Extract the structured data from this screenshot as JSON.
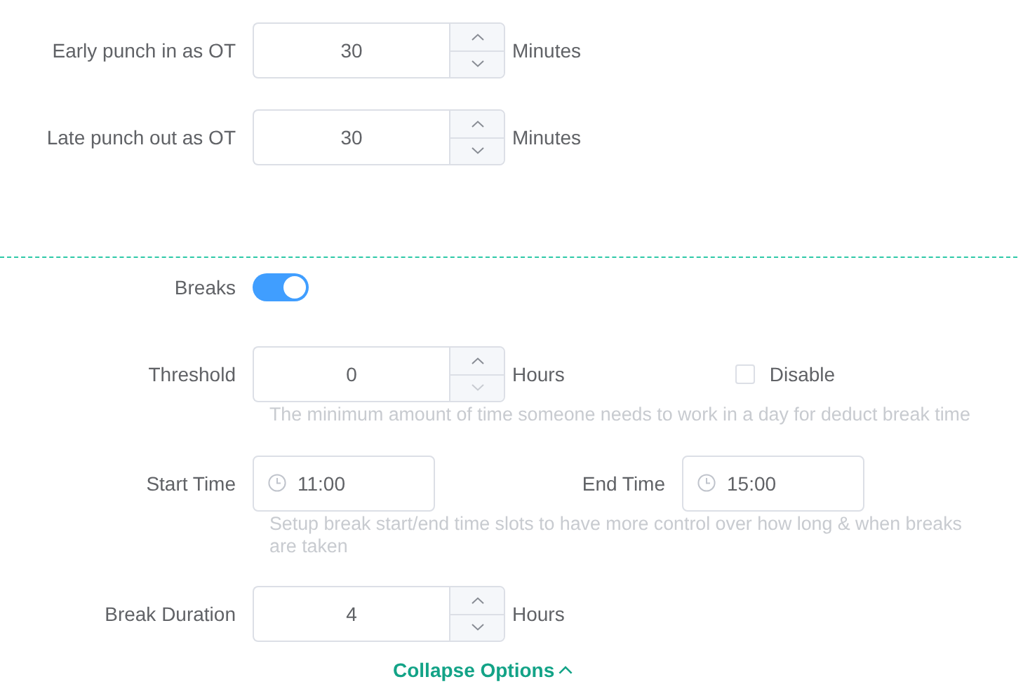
{
  "overtime": [
    {
      "label": "Early punch in as OT",
      "value": "30",
      "unit": "Minutes",
      "decrease_disabled": false
    },
    {
      "label": "Late punch out as OT",
      "value": "30",
      "unit": "Minutes",
      "decrease_disabled": false
    }
  ],
  "breaks": {
    "label": "Breaks",
    "on": true
  },
  "threshold": {
    "label": "Threshold",
    "value": "0",
    "unit": "Hours",
    "decrease_disabled": true,
    "disable_option": {
      "label": "Disable",
      "checked": false
    },
    "hint": "The minimum amount of time someone needs to work in a day for deduct break time"
  },
  "time_slots": {
    "start": {
      "label": "Start Time",
      "value": "11:00"
    },
    "end": {
      "label": "End Time",
      "value": "15:00"
    },
    "hint": "Setup break start/end time slots to have more control over how long & when breaks are taken"
  },
  "break_duration": {
    "label": "Break Duration",
    "value": "4",
    "unit": "Hours",
    "decrease_disabled": false
  },
  "collapse_link": {
    "label": "Collapse Options"
  }
}
